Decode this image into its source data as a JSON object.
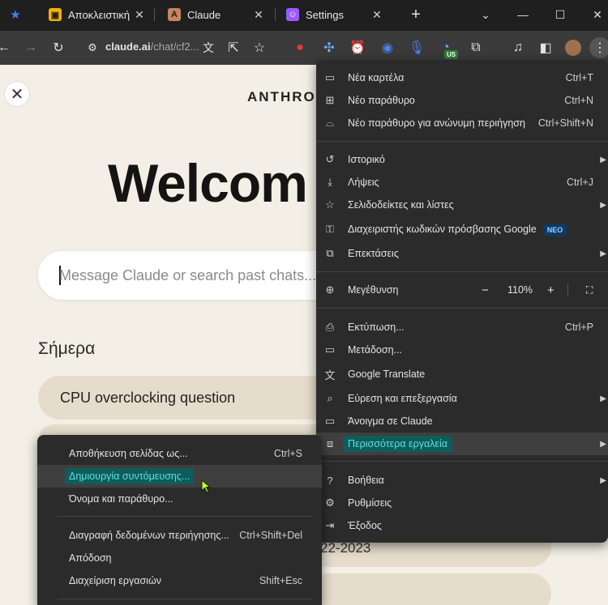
{
  "tabs": [
    {
      "title": "Αποκλειστική",
      "fav_color": "#f5b400",
      "fav_glyph": "▣"
    },
    {
      "title": "Claude",
      "fav_color": "#c9855f",
      "fav_glyph": "A\\"
    },
    {
      "title": "Settings",
      "fav_color": "#9b59ff",
      "fav_glyph": "☺"
    }
  ],
  "toolbar": {
    "url_host": "claude.ai",
    "url_path": "/chat/cf2...",
    "extension_badge": "US"
  },
  "page": {
    "brand": "ANTHRO",
    "welcome": "Welcom",
    "search_placeholder": "Message Claude or search past chats...",
    "section_today": "Σήμερα",
    "chat_item": "CPU overclocking question",
    "date_text": "22-2023"
  },
  "menu": {
    "new_tab": {
      "label": "Νέα καρτέλα",
      "shortcut": "Ctrl+T"
    },
    "new_window": {
      "label": "Νέο παράθυρο",
      "shortcut": "Ctrl+N"
    },
    "incognito": {
      "label": "Νέο παράθυρο για ανώνυμη περιήγηση",
      "shortcut": "Ctrl+Shift+N"
    },
    "history": {
      "label": "Ιστορικό"
    },
    "downloads": {
      "label": "Λήψεις",
      "shortcut": "Ctrl+J"
    },
    "bookmarks": {
      "label": "Σελιδοδείκτες και λίστες"
    },
    "passwords": {
      "label": "Διαχειριστής κωδικών πρόσβασης Google",
      "badge": "ΝΕΟ"
    },
    "extensions": {
      "label": "Επεκτάσεις"
    },
    "zoom": {
      "label": "Μεγέθυνση",
      "minus": "−",
      "value": "110%",
      "plus": "+"
    },
    "print": {
      "label": "Εκτύπωση...",
      "shortcut": "Ctrl+P"
    },
    "cast": {
      "label": "Μετάδοση..."
    },
    "translate": {
      "label": "Google Translate"
    },
    "find_edit": {
      "label": "Εύρεση και επεξεργασία"
    },
    "open_in": {
      "label": "Άνοιγμα σε Claude"
    },
    "more_tools": {
      "label": "Περισσότερα εργαλεία"
    },
    "help": {
      "label": "Βοήθεια"
    },
    "settings": {
      "label": "Ρυθμίσεις"
    },
    "exit": {
      "label": "Έξοδος"
    }
  },
  "submenu": {
    "save_page": {
      "label": "Αποθήκευση σελίδας ως...",
      "shortcut": "Ctrl+S"
    },
    "create_shortcut": {
      "label": "Δημιουργία συντόμευσης..."
    },
    "name_window": {
      "label": "Όνομα και παράθυρο..."
    },
    "clear_data": {
      "label": "Διαγραφή δεδομένων περιήγησης...",
      "shortcut": "Ctrl+Shift+Del"
    },
    "performance": {
      "label": "Απόδοση"
    },
    "task_manager": {
      "label": "Διαχείριση εργασιών",
      "shortcut": "Shift+Esc"
    }
  },
  "colors": {
    "highlight_bg": "#0f5c5c",
    "highlight_text": "#5ee0e0",
    "menu_bg": "#2b2b2b",
    "page_bg": "#f3efe6",
    "pill_bg": "#e6dccb"
  }
}
